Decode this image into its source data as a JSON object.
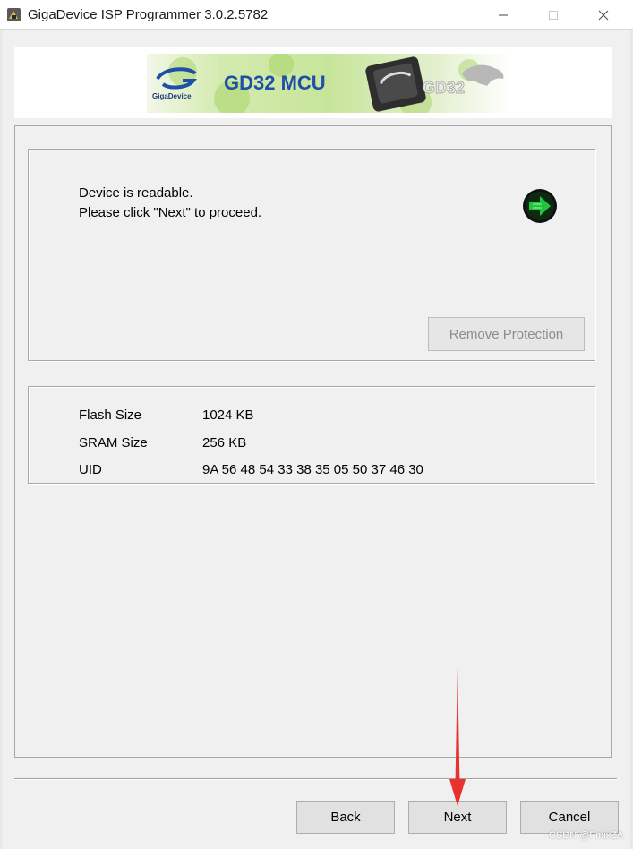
{
  "window": {
    "title": "GigaDevice ISP Programmer 3.0.2.5782"
  },
  "banner": {
    "logo_text": "GigaDevice",
    "product_text": "GD32 MCU",
    "chip_text": "GD32"
  },
  "status": {
    "line1": "Device is readable.",
    "line2": "Please click \"Next\" to proceed.",
    "icon": "green-arrow-icon",
    "remove_protection_label": "Remove Protection"
  },
  "device_info": {
    "rows": [
      {
        "label": "Flash Size",
        "value": "1024 KB"
      },
      {
        "label": "SRAM Size",
        "value": "256 KB"
      },
      {
        "label": "UID",
        "value": "9A 56 48 54 33 38 35 05 50 37 46 30"
      }
    ]
  },
  "footer": {
    "back_label": "Back",
    "next_label": "Next",
    "cancel_label": "Cancel"
  },
  "watermark": "CSDN @FmixZA",
  "colors": {
    "window_bg": "#f0f0f0",
    "button_bg": "#e1e1e1",
    "status_green": "#1fbf3f",
    "annotation_red": "#e8322d"
  }
}
